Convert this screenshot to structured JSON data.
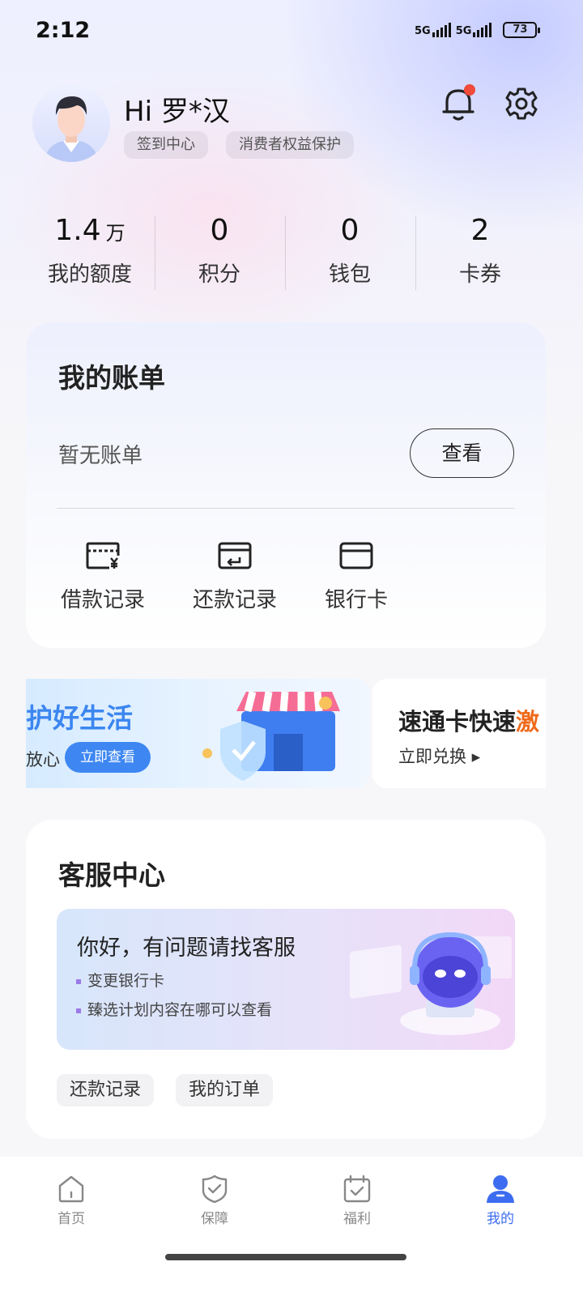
{
  "status_bar": {
    "time": "2:12",
    "network1": "5G",
    "network2": "5G",
    "battery": "73"
  },
  "profile": {
    "greeting": "Hi 罗*汉",
    "chips": [
      "签到中心",
      "消费者权益保护"
    ]
  },
  "stats": [
    {
      "value": "1.4",
      "unit": "万",
      "label": "我的额度"
    },
    {
      "value": "0",
      "unit": "",
      "label": "积分"
    },
    {
      "value": "0",
      "unit": "",
      "label": "钱包"
    },
    {
      "value": "2",
      "unit": "",
      "label": "卡券"
    }
  ],
  "bill": {
    "title": "我的账单",
    "empty_text": "暂无账单",
    "view_button": "查看",
    "quick_actions": [
      "借款记录",
      "还款记录",
      "银行卡"
    ]
  },
  "banners": {
    "banner1": {
      "title": "护好生活",
      "subtitle": "放心",
      "button": "立即查看"
    },
    "banner2": {
      "title_plain": "速通卡快速",
      "title_highlight": "激",
      "link": "立即兑换 ▸"
    }
  },
  "service": {
    "title": "客服中心",
    "hello": "你好，有问题请找客服",
    "items": [
      "变更银行卡",
      "臻选计划内容在哪可以查看"
    ],
    "tags": [
      "还款记录",
      "我的订单"
    ]
  },
  "bottom_nav": {
    "items": [
      "首页",
      "保障",
      "福利",
      "我的"
    ],
    "active_index": 3,
    "active_color": "#3d6cf0",
    "inactive_color": "#888888"
  }
}
